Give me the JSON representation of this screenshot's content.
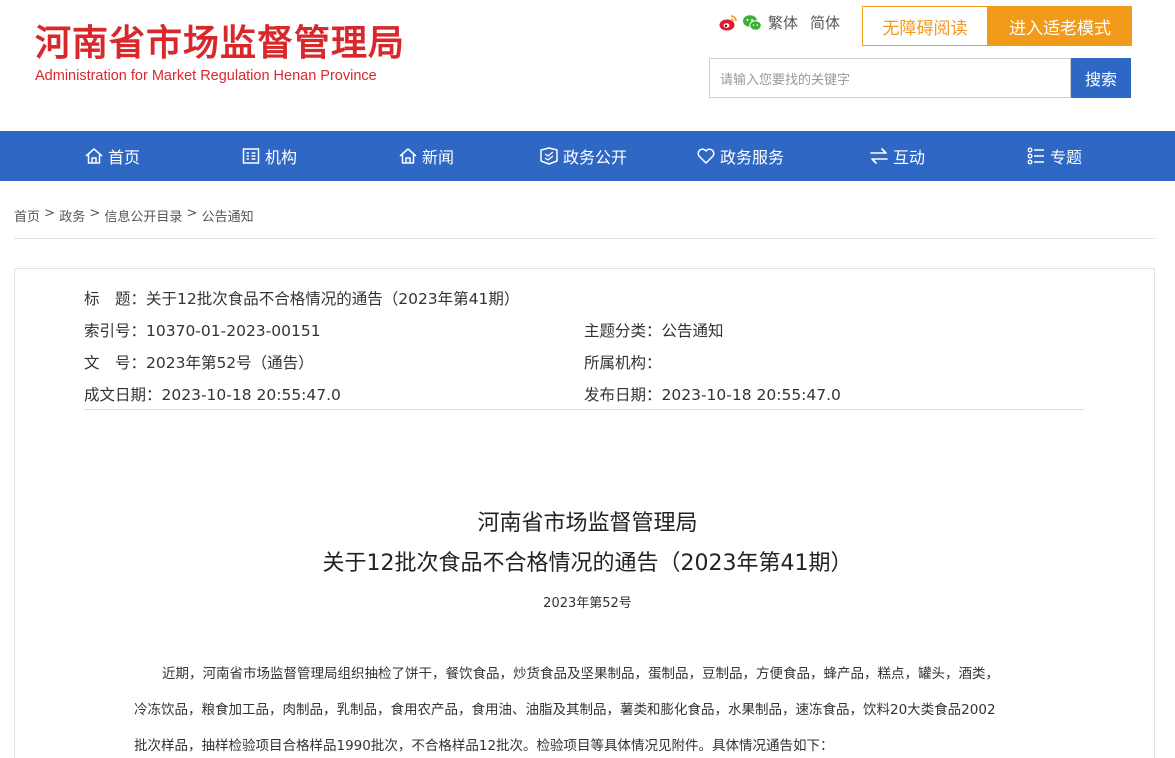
{
  "header": {
    "logo_cn": "河南省市场监督管理局",
    "logo_en": "Administration for Market Regulation Henan Province",
    "weibo_icon": "weibo-icon",
    "wechat_icon": "wechat-icon",
    "traditional": "繁体",
    "simplified": "简体",
    "accessible_reading": "无障碍阅读",
    "elder_mode": "进入适老模式",
    "search_placeholder": "请输入您要找的关键字",
    "search_button": "搜索",
    "brand_red": "#d8282c",
    "accent_orange": "#f29a1a",
    "accent_blue": "#2e67c4"
  },
  "nav": {
    "items": [
      {
        "label": "首页",
        "icon": "home-icon"
      },
      {
        "label": "机构",
        "icon": "org-icon"
      },
      {
        "label": "新闻",
        "icon": "news-icon"
      },
      {
        "label": "政务公开",
        "icon": "open-government-icon"
      },
      {
        "label": "政务服务",
        "icon": "service-heart-icon"
      },
      {
        "label": "互动",
        "icon": "interact-arrows-icon"
      },
      {
        "label": "专题",
        "icon": "topic-list-icon"
      }
    ]
  },
  "breadcrumb": {
    "items": [
      "首页",
      "政务",
      "信息公开目录",
      "公告通知"
    ],
    "separator": " > "
  },
  "meta": {
    "title": "标　题：关于12批次食品不合格情况的通告（2023年第41期）",
    "index_no": "索引号：10370-01-2023-00151",
    "category": "主题分类：公告通知",
    "doc_no": "文　号：2023年第52号（通告）",
    "agency": "所属机构：",
    "created": "成文日期：2023-10-18 20:55:47.0",
    "published": "发布日期：2023-10-18 20:55:47.0"
  },
  "article": {
    "heading_line1": "河南省市场监督管理局",
    "heading_line2": "关于12批次食品不合格情况的通告（2023年第41期）",
    "doc_number": "2023年第52号",
    "body_lines": [
      "近期，河南省市场监督管理局组织抽检了饼干，餐饮食品，炒货食品及坚果制品，蛋制品，豆制品，方便食品，蜂产品，糕点，罐头，酒类，",
      "冷冻饮品，粮食加工品，肉制品，乳制品，食用农产品，食用油、油脂及其制品，薯类和膨化食品，水果制品，速冻食品，饮料20大类食品2002",
      "批次样品，抽样检验项目合格样品1990批次，不合格样品12批次。检验项目等具体情况见附件。具体情况通告如下："
    ]
  }
}
